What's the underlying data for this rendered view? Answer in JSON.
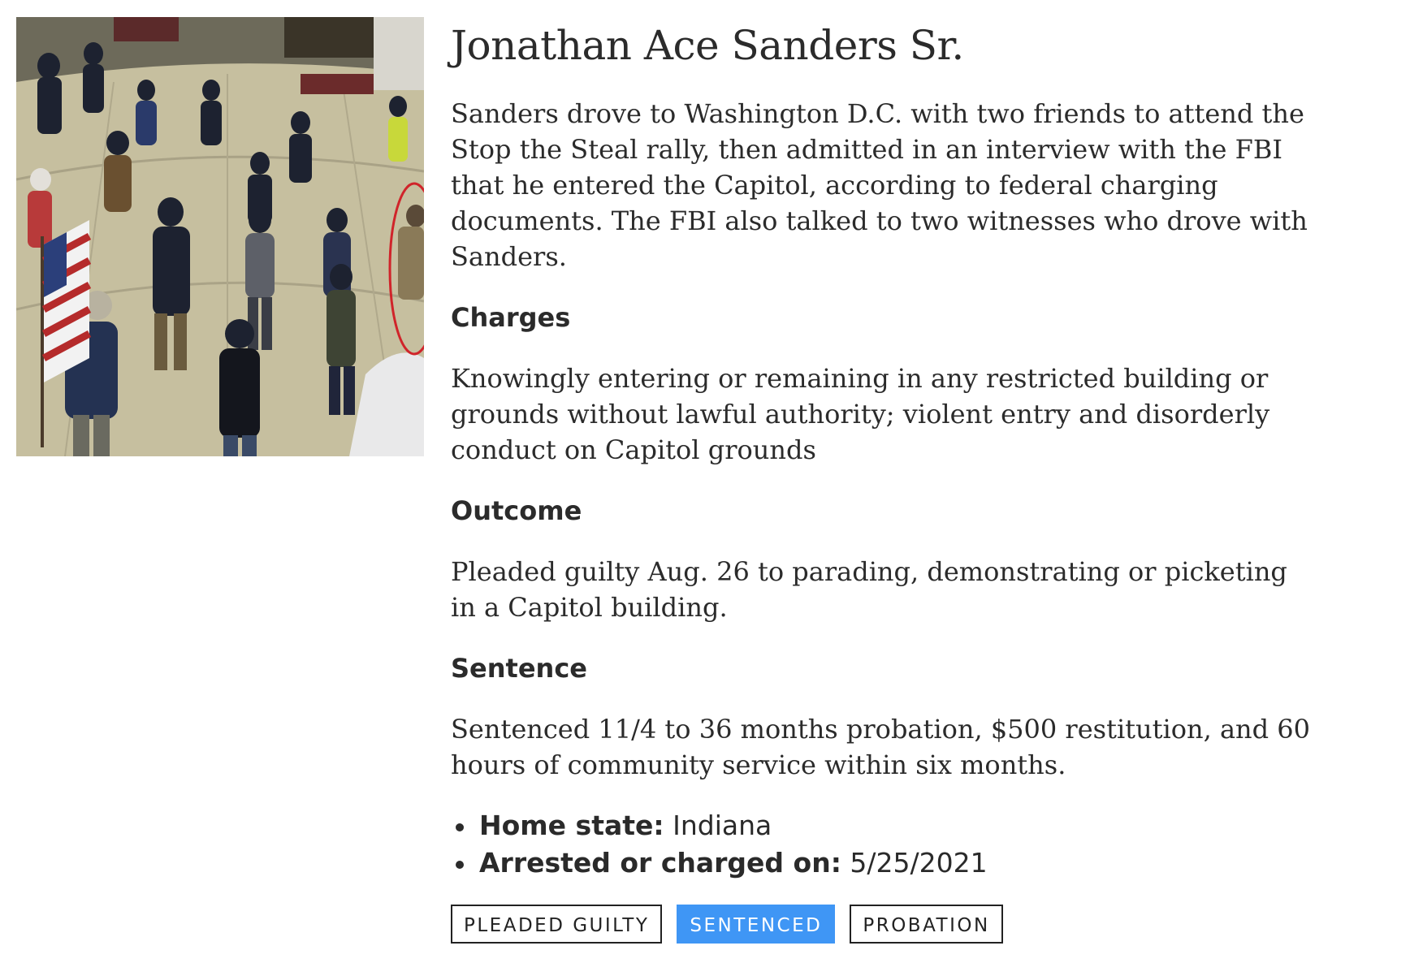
{
  "profile": {
    "name": "Jonathan Ace Sanders Sr.",
    "photo_alt": "surveillance-still"
  },
  "summary": "Sanders drove to Washington D.C. with two friends to attend the Stop the Steal rally, then admitted in an interview with the FBI that he entered the Capitol, according to federal charging documents. The FBI also talked to two witnesses who drove with Sanders.",
  "sections": {
    "charges": {
      "heading": "Charges",
      "text": "Knowingly entering or remaining in any restricted building or grounds without lawful authority; violent entry and disorderly conduct on Capitol grounds"
    },
    "outcome": {
      "heading": "Outcome",
      "text": "Pleaded guilty Aug. 26 to parading, demonstrating or picketing in a Capitol building."
    },
    "sentence": {
      "heading": "Sentence",
      "text": "Sentenced 11/4 to 36 months probation, $500 restitution, and 60 hours of community service within six months."
    }
  },
  "facts": [
    {
      "label": "Home state:",
      "value": "Indiana"
    },
    {
      "label": "Arrested or charged on:",
      "value": "5/25/2021"
    }
  ],
  "tags": [
    {
      "label": "PLEADED GUILTY",
      "active": false
    },
    {
      "label": "SENTENCED",
      "active": true
    },
    {
      "label": "PROBATION",
      "active": false
    }
  ],
  "colors": {
    "tag_active": "#3f96f5",
    "text": "#2b2b2b",
    "highlight_circle": "#d0242a"
  }
}
